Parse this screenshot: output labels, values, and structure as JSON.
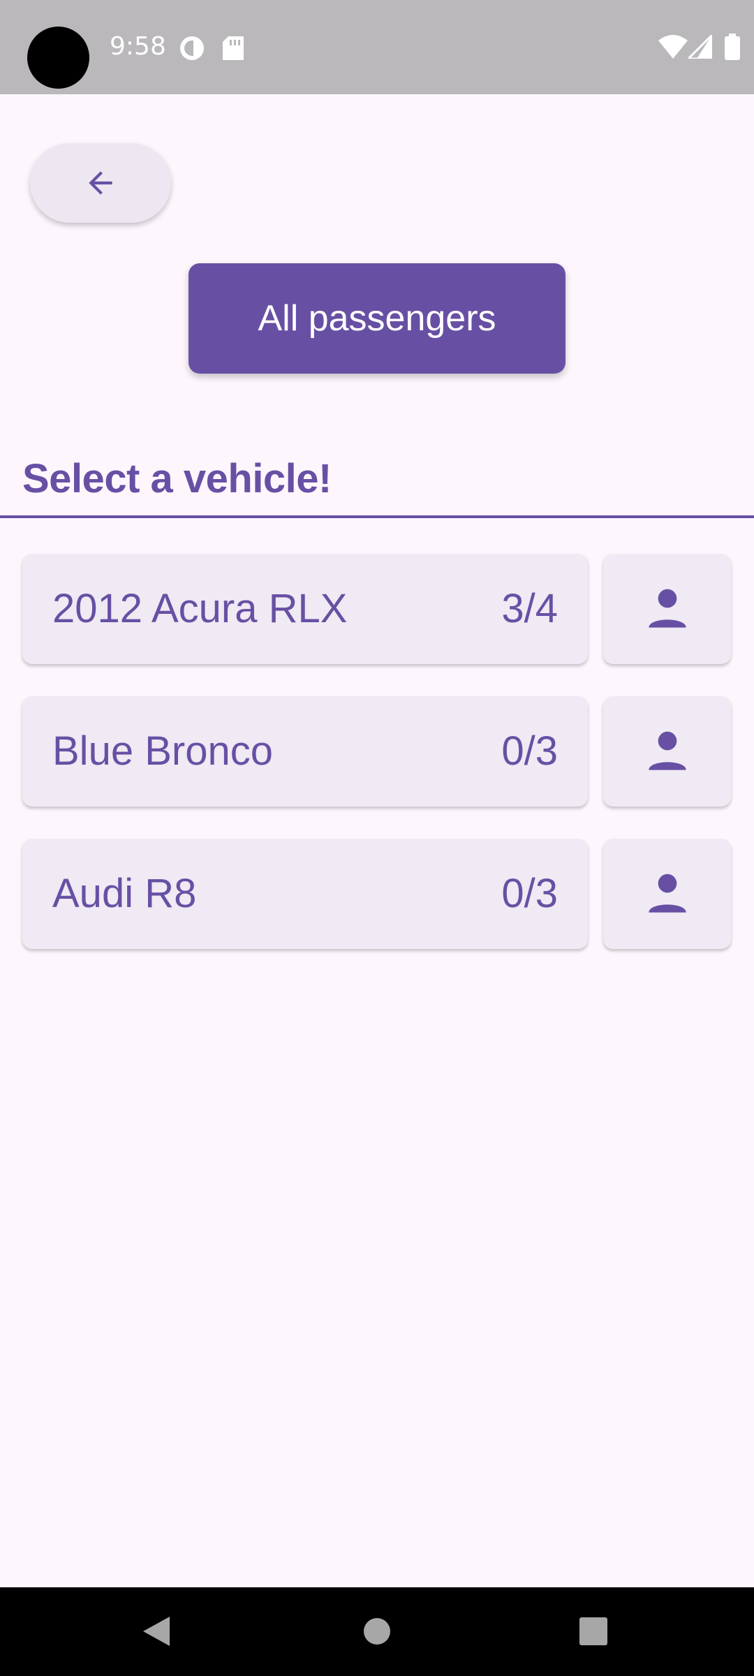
{
  "status_bar": {
    "time": "9:58",
    "icons": [
      "camera-cutout",
      "sync-status-icon",
      "sd-card-icon",
      "wifi-icon",
      "cellular-signal-icon",
      "battery-icon"
    ]
  },
  "header": {
    "back_icon": "arrow-back-icon",
    "primary_button_label": "All passengers"
  },
  "vehicles_section": {
    "title": "Select a vehicle!",
    "vehicles": [
      {
        "name": "2012 Acura RLX",
        "occupancy": "3/4",
        "action_icon": "person-icon"
      },
      {
        "name": "Blue Bronco",
        "occupancy": "0/3",
        "action_icon": "person-icon"
      },
      {
        "name": "Audi R8",
        "occupancy": "0/3",
        "action_icon": "person-icon"
      }
    ]
  },
  "nav_bar": {
    "buttons": [
      "nav-back-icon",
      "nav-home-icon",
      "nav-recents-icon"
    ]
  },
  "colors": {
    "primary": "#6750A4",
    "background": "#FDF7FD",
    "surface": "#EFEAF3",
    "status_bar": "#BAB8BB",
    "nav_bar": "#000000"
  }
}
